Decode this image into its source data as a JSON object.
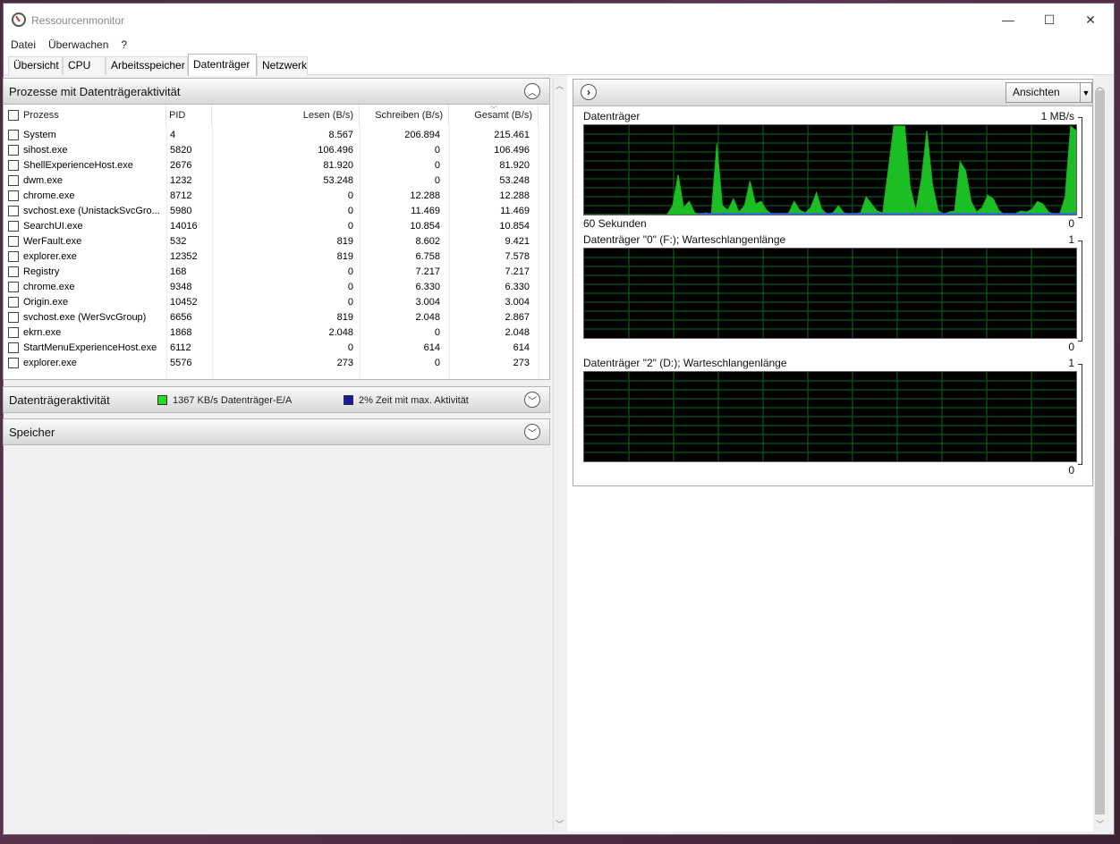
{
  "window": {
    "title": "Ressourcenmonitor",
    "controls": {
      "minimize": "—",
      "maximize": "☐",
      "close": "✕"
    }
  },
  "menu": [
    "Datei",
    "Überwachen",
    "?"
  ],
  "tabs": [
    "Übersicht",
    "CPU",
    "Arbeitsspeicher",
    "Datenträger",
    "Netzwerk"
  ],
  "active_tab": "Datenträger",
  "processes_section": {
    "title": "Prozesse mit Datenträgeraktivität",
    "collapse_glyph": "︿",
    "columns": [
      "Prozess",
      "PID",
      "Lesen (B/s)",
      "Schreiben (B/s)",
      "Gesamt (B/s)"
    ],
    "sort_indicator": "﹀",
    "rows": [
      [
        "System",
        "4",
        "8.567",
        "206.894",
        "215.461"
      ],
      [
        "sihost.exe",
        "5820",
        "106.496",
        "0",
        "106.496"
      ],
      [
        "ShellExperienceHost.exe",
        "2676",
        "81.920",
        "0",
        "81.920"
      ],
      [
        "dwm.exe",
        "1232",
        "53.248",
        "0",
        "53.248"
      ],
      [
        "chrome.exe",
        "8712",
        "0",
        "12.288",
        "12.288"
      ],
      [
        "svchost.exe (UnistackSvcGro...",
        "5980",
        "0",
        "11.469",
        "11.469"
      ],
      [
        "SearchUI.exe",
        "14016",
        "0",
        "10.854",
        "10.854"
      ],
      [
        "WerFault.exe",
        "532",
        "819",
        "8.602",
        "9.421"
      ],
      [
        "explorer.exe",
        "12352",
        "819",
        "6.758",
        "7.578"
      ],
      [
        "Registry",
        "168",
        "0",
        "7.217",
        "7.217"
      ],
      [
        "chrome.exe",
        "9348",
        "0",
        "6.330",
        "6.330"
      ],
      [
        "Origin.exe",
        "10452",
        "0",
        "3.004",
        "3.004"
      ],
      [
        "svchost.exe (WerSvcGroup)",
        "6656",
        "819",
        "2.048",
        "2.867"
      ],
      [
        "ekrn.exe",
        "1868",
        "2.048",
        "0",
        "2.048"
      ],
      [
        "StartMenuExperienceHost.exe",
        "6112",
        "0",
        "614",
        "614"
      ],
      [
        "explorer.exe",
        "5576",
        "273",
        "0",
        "273"
      ]
    ]
  },
  "disk_activity_section": {
    "title": "Datenträgeraktivität",
    "io_text": "1367 KB/s Datenträger-E/A",
    "io_color": "#22dd22",
    "active_text": "2% Zeit mit max. Aktivität",
    "active_color": "#1a1aa0",
    "expand_glyph": "﹀"
  },
  "storage_section": {
    "title": "Speicher",
    "expand_glyph": "﹀"
  },
  "graph_panel": {
    "nav_glyph": "›",
    "views_button": "Ansichten",
    "dropdown_glyph": "▼",
    "charts": [
      {
        "title": "Datenträger",
        "max_label": "1 MB/s",
        "bottom_left": "60 Sekunden",
        "min_label": "0",
        "series": [
          0,
          0,
          0,
          0,
          0,
          0,
          0,
          0,
          0,
          0,
          0,
          0,
          0,
          0,
          0,
          0,
          0.1,
          0.45,
          0.08,
          0.15,
          0.02,
          0,
          0.02,
          0,
          0.8,
          0.1,
          0.05,
          0.18,
          0.03,
          0.1,
          0.38,
          0.12,
          0.15,
          0.05,
          0,
          0,
          0,
          0.02,
          0.15,
          0.05,
          0.02,
          0.08,
          0.25,
          0.06,
          0,
          0.02,
          0.1,
          0.02,
          0,
          0.01,
          0.02,
          0.2,
          0.12,
          0.04,
          0.02,
          0.5,
          1.0,
          1.0,
          1.0,
          0.3,
          0.05,
          0.4,
          0.95,
          0.35,
          0.05,
          0,
          0.03,
          0.04,
          0.6,
          0.5,
          0.15,
          0.03,
          0.08,
          0.22,
          0.18,
          0.05,
          0,
          0,
          0.01,
          0.04,
          0.03,
          0.06,
          0.15,
          0.12,
          0.03,
          0,
          0,
          0.2,
          1.0,
          0.95
        ]
      },
      {
        "title": "Datenträger \"0\" (F:); Warteschlangenlänge",
        "max_label": "1",
        "min_label": "0",
        "series": []
      },
      {
        "title": "Datenträger \"2\" (D:); Warteschlangenlänge",
        "max_label": "1",
        "min_label": "0",
        "series": []
      }
    ]
  },
  "colors": {
    "graph_line": "#1faa2a",
    "graph_fill": "#1bbf24",
    "grid": "#0c6b1c",
    "chart_bg": "#000000"
  }
}
